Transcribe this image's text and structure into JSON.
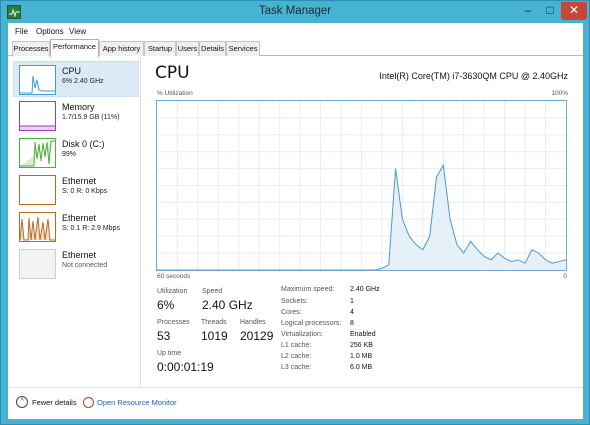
{
  "window": {
    "title": "Task Manager",
    "min_icon": "–",
    "max_icon": "□",
    "close_icon": "✕"
  },
  "menu": [
    "File",
    "Options",
    "View"
  ],
  "tabs": [
    "Processes",
    "Performance",
    "App history",
    "Startup",
    "Users",
    "Details",
    "Services"
  ],
  "sidebar": [
    {
      "title": "CPU",
      "subtitle": "6% 2.40 GHz",
      "color": "#4a9bc9",
      "active": true
    },
    {
      "title": "Memory",
      "subtitle": "1.7/15.9 GB (11%)",
      "color": "#9b3fb5"
    },
    {
      "title": "Disk 0 (C:)",
      "subtitle": "99%",
      "color": "#4caf3c"
    },
    {
      "title": "Ethernet",
      "subtitle": "S: 0 R: 0 Kbps",
      "color": "#b86b1e"
    },
    {
      "title": "Ethernet",
      "subtitle": "S: 0.1 R: 2.9 Mbps",
      "color": "#b86b1e"
    },
    {
      "title": "Ethernet",
      "subtitle": "Not connected",
      "color": "#bdbdbd"
    }
  ],
  "main": {
    "title": "CPU",
    "model": "Intel(R) Core(TM) i7-3630QM CPU @ 2.40GHz",
    "util_label": "% Utilization",
    "util_max": "100%",
    "time_left": "60 seconds",
    "time_right": "0"
  },
  "stats": {
    "utilization_label": "Utilization",
    "utilization": "6%",
    "speed_label": "Speed",
    "speed": "2.40 GHz",
    "processes_label": "Processes",
    "processes": "53",
    "threads_label": "Threads",
    "threads": "1019",
    "handles_label": "Handles",
    "handles": "20129",
    "uptime_label": "Up time",
    "uptime": "0:00:01:19"
  },
  "specs": [
    {
      "label": "Maximum speed:",
      "value": "2.40 GHz"
    },
    {
      "label": "Sockets:",
      "value": "1"
    },
    {
      "label": "Cores:",
      "value": "4"
    },
    {
      "label": "Logical processors:",
      "value": "8"
    },
    {
      "label": "Virtualization:",
      "value": "Enabled"
    },
    {
      "label": "L1 cache:",
      "value": "256 KB"
    },
    {
      "label": "L2 cache:",
      "value": "1.0 MB"
    },
    {
      "label": "L3 cache:",
      "value": "6.0 MB"
    }
  ],
  "footer": {
    "fewer": "Fewer details",
    "monitor": "Open Resource Monitor"
  },
  "chart_data": {
    "type": "area",
    "title": "",
    "xlabel": "",
    "ylabel": "% Utilization",
    "xlim": [
      60,
      0
    ],
    "ylim": [
      0,
      100
    ],
    "x": [
      60,
      58,
      56,
      54,
      52,
      50,
      48,
      46,
      44,
      42,
      40,
      38,
      36,
      34,
      32,
      30,
      28,
      27,
      26,
      25,
      24,
      23,
      22,
      21,
      20,
      19,
      18,
      17,
      16,
      15,
      14,
      13,
      12,
      11,
      10,
      9,
      8,
      7,
      6,
      5,
      4,
      3,
      2,
      1,
      0
    ],
    "values": [
      0,
      0,
      0,
      0,
      0,
      0,
      0,
      0,
      0,
      0,
      0,
      0,
      0,
      0,
      0,
      0,
      0,
      1,
      3,
      60,
      30,
      20,
      15,
      12,
      20,
      55,
      62,
      30,
      15,
      10,
      17,
      12,
      8,
      6,
      10,
      7,
      5,
      6,
      4,
      12,
      10,
      6,
      4,
      5,
      6
    ],
    "grid": true,
    "color": "#4a9bc9"
  }
}
